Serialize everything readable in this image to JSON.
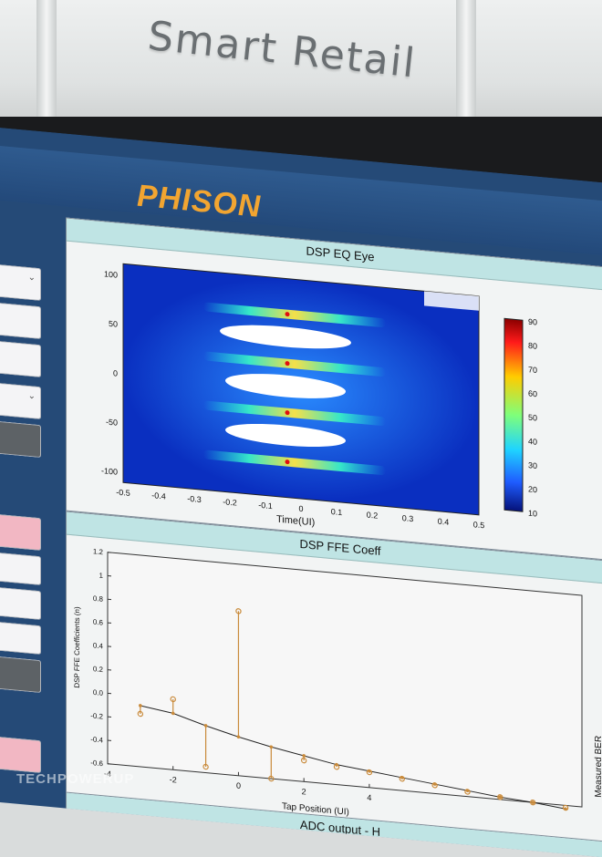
{
  "wall_sign": "Smart Retail",
  "brand": "PHISON",
  "eye_panel": {
    "title": "DSP EQ Eye",
    "xlabel": "Time(UI)",
    "x_ticks": [
      "-0.5",
      "-0.4",
      "-0.3",
      "-0.2",
      "-0.1",
      "0",
      "0.1",
      "0.2",
      "0.3",
      "0.4",
      "0.5"
    ],
    "y_ticks": [
      "100",
      "50",
      "0",
      "-50",
      "-100"
    ],
    "colorbar_ticks": [
      "90",
      "80",
      "70",
      "60",
      "50",
      "40",
      "30",
      "20",
      "10"
    ]
  },
  "ffe_panel": {
    "title": "DSP FFE Coeff",
    "ylabel": "DSP FFE Coefficients (n)",
    "xlabel": "Tap Position (UI)",
    "y_ticks": [
      "1.2",
      "1",
      "0.8",
      "0.6",
      "0.4",
      "0.2",
      "0.0",
      "-0.2",
      "-0.4",
      "-0.6"
    ],
    "x_ticks": [
      "-4",
      "-2",
      "0",
      "2",
      "4"
    ],
    "right_label": "Measured BER"
  },
  "adc_panel": {
    "title": "ADC output - H"
  },
  "watermark": "TECHPOWERUP",
  "chart_data": {
    "type": "scatter",
    "title": "DSP FFE Coeff",
    "xlabel": "Tap Position (UI)",
    "ylabel": "DSP FFE Coefficients (n)",
    "xlim": [
      -4,
      10.5
    ],
    "ylim": [
      -0.6,
      1.2
    ],
    "x": [
      -3,
      -2,
      -1,
      0,
      1,
      2,
      3,
      4,
      5,
      6,
      7,
      8,
      9,
      10
    ],
    "series": [
      {
        "values": [
          -0.15,
          0.0,
          -0.55,
          0.8,
          -0.6,
          -0.42,
          -0.45,
          -0.47,
          -0.5,
          -0.53,
          -0.56,
          -0.58,
          -0.6,
          -0.62
        ]
      },
      {
        "values": [
          -0.08,
          -0.12,
          -0.2,
          -0.27,
          -0.33,
          -0.38,
          -0.43,
          -0.46,
          -0.49,
          -0.52,
          -0.55,
          -0.58,
          -0.6,
          -0.63
        ]
      }
    ]
  }
}
